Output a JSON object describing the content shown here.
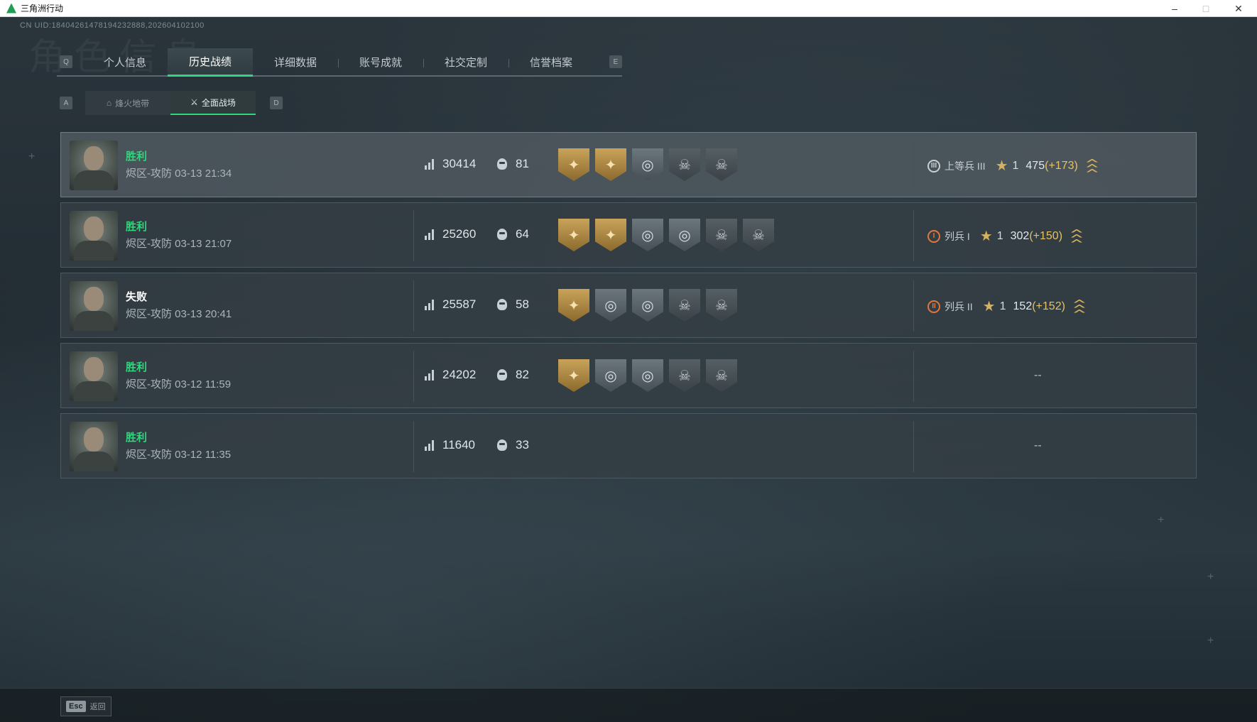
{
  "window": {
    "title": "三角洲行动",
    "minimize": "–",
    "maximize": "□",
    "close": "✕"
  },
  "uid": "CN UID:18404261478194232888,202604102100",
  "bg_heading": "角色信息",
  "tabs": {
    "key_left": "Q",
    "key_right": "E",
    "items": [
      {
        "label": "个人信息"
      },
      {
        "label": "历史战绩",
        "active": true
      },
      {
        "label": "详细数据"
      },
      {
        "label": "账号成就"
      },
      {
        "label": "社交定制"
      },
      {
        "label": "信誉档案"
      }
    ]
  },
  "subtabs": {
    "key_left": "A",
    "key_right": "D",
    "items": [
      {
        "label": "烽火地带",
        "icon": "outpost-icon"
      },
      {
        "label": "全面战场",
        "icon": "battlefield-icon",
        "active": true
      }
    ]
  },
  "matches": [
    {
      "result": "胜利",
      "result_type": "win",
      "meta": "烬区-攻防 03-13 21:34",
      "score": "30414",
      "kills": "81",
      "badges": [
        "gold",
        "gold",
        "gray",
        "dark",
        "dark"
      ],
      "rank": {
        "name": "上等兵 III",
        "numeral": "III",
        "icon_color": "#c9cfd2",
        "level": "1",
        "points": "475",
        "delta": "(+173)"
      }
    },
    {
      "result": "胜利",
      "result_type": "win",
      "meta": "烬区-攻防 03-13 21:07",
      "score": "25260",
      "kills": "64",
      "badges": [
        "gold",
        "gold",
        "gray",
        "gray",
        "dark",
        "dark"
      ],
      "rank": {
        "name": "列兵 I",
        "numeral": "I",
        "icon_color": "#e0773b",
        "level": "1",
        "points": "302",
        "delta": "(+150)"
      }
    },
    {
      "result": "失败",
      "result_type": "lose",
      "meta": "烬区-攻防 03-13 20:41",
      "score": "25587",
      "kills": "58",
      "badges": [
        "gold",
        "gray",
        "gray",
        "dark",
        "dark"
      ],
      "rank": {
        "name": "列兵 II",
        "numeral": "II",
        "icon_color": "#e0773b",
        "level": "1",
        "points": "152",
        "delta": "(+152)"
      }
    },
    {
      "result": "胜利",
      "result_type": "win",
      "meta": "烬区-攻防 03-12 11:59",
      "score": "24202",
      "kills": "82",
      "badges": [
        "gold",
        "gray",
        "gray",
        "dark",
        "dark"
      ],
      "rank": null,
      "no_rank": "--"
    },
    {
      "result": "胜利",
      "result_type": "win",
      "meta": "烬区-攻防 03-12 11:35",
      "score": "11640",
      "kills": "33",
      "badges": [],
      "rank": null,
      "no_rank": "--"
    }
  ],
  "footer": {
    "esc_key": "Esc",
    "back_label": "返回"
  },
  "colors": {
    "accent": "#2fd67c",
    "gold": "#d8b15b"
  }
}
